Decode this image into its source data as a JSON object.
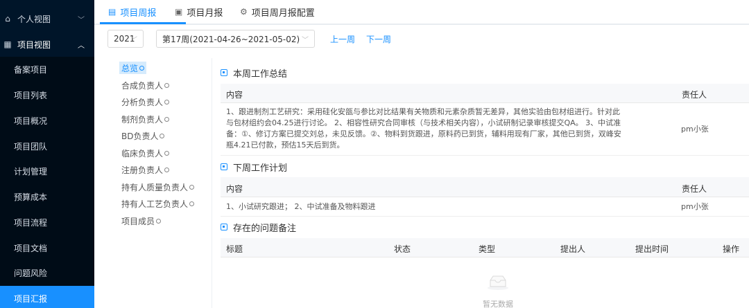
{
  "sidebar": {
    "personal_view": "个人视图",
    "project_view": "项目视图",
    "items": [
      {
        "label": "备案项目"
      },
      {
        "label": "项目列表"
      },
      {
        "label": "项目概况"
      },
      {
        "label": "项目团队"
      },
      {
        "label": "计划管理"
      },
      {
        "label": "预算成本"
      },
      {
        "label": "项目流程"
      },
      {
        "label": "项目文档"
      },
      {
        "label": "问题风险"
      },
      {
        "label": "项目汇报",
        "active": true
      }
    ]
  },
  "tabs": [
    {
      "label": "项目周报",
      "icon": "report-icon",
      "active": true
    },
    {
      "label": "项目月报",
      "icon": "calendar-icon"
    },
    {
      "label": "项目周月报配置",
      "icon": "gear-icon"
    }
  ],
  "filters": {
    "year": "2021",
    "week": "第17周(2021-04-26~2021-05-02)",
    "prev_week": "上一周",
    "next_week": "下一周"
  },
  "roles": [
    {
      "label": "总览",
      "active": true
    },
    {
      "label": "合成负责人"
    },
    {
      "label": "分析负责人"
    },
    {
      "label": "制剂负责人"
    },
    {
      "label": "BD负责人"
    },
    {
      "label": "临床负责人"
    },
    {
      "label": "注册负责人"
    },
    {
      "label": "持有人质量负责人"
    },
    {
      "label": "持有人工艺负责人"
    },
    {
      "label": "项目成员"
    }
  ],
  "summary": {
    "title": "本周工作总结",
    "col_content": "内容",
    "col_owner": "责任人",
    "lines": [
      "1、跟进制剂工艺研究：采用硅化安瓿与参比对比结果有关物质和元素杂质暂无差异，其他实验由包材组进行。针对此",
      "与包材组约会04.25进行讨论。 2、相容性研究合同审核（与技术相关内容），小试研制记录审核提交QA。 3、中试准",
      "备：①、修订方案已提交刘总，未见反馈。②、物料到货跟进，原料药已到货，辅料用现有厂家，其他已到货，双峰安",
      "瓶4.21已付款，预估15天后到货。"
    ],
    "owner": "pm小张"
  },
  "plan": {
    "title": "下周工作计划",
    "col_content": "内容",
    "col_owner": "责任人",
    "content": "1、小试研究跟进； 2、中试准备及物料跟进",
    "owner": "pm小张"
  },
  "issues": {
    "title": "存在的问题备注",
    "cols": [
      "标题",
      "状态",
      "类型",
      "提出人",
      "提出时间",
      "操作"
    ],
    "empty": "暂无数据"
  },
  "colors": {
    "accent": "#1890ff",
    "sidebar": "#001529"
  }
}
